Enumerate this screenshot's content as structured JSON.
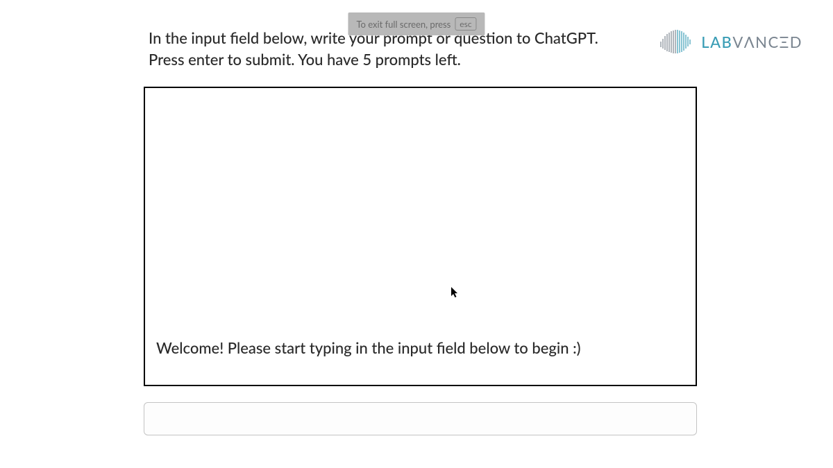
{
  "fullscreen": {
    "text": "To exit full screen, press",
    "key": "esc"
  },
  "instruction": {
    "line1": "In the input field below, write your prompt or question to ChatGPT.",
    "line2": "Press enter to submit. You have 5 prompts left."
  },
  "logo": {
    "lab": "LAB",
    "v": "V",
    "a": "Λ",
    "nc": "NC",
    "e": "Ξ",
    "d": "D"
  },
  "chat": {
    "welcome": "Welcome! Please start typing in the input field below to begin :)"
  },
  "input": {
    "value": "",
    "placeholder": ""
  }
}
